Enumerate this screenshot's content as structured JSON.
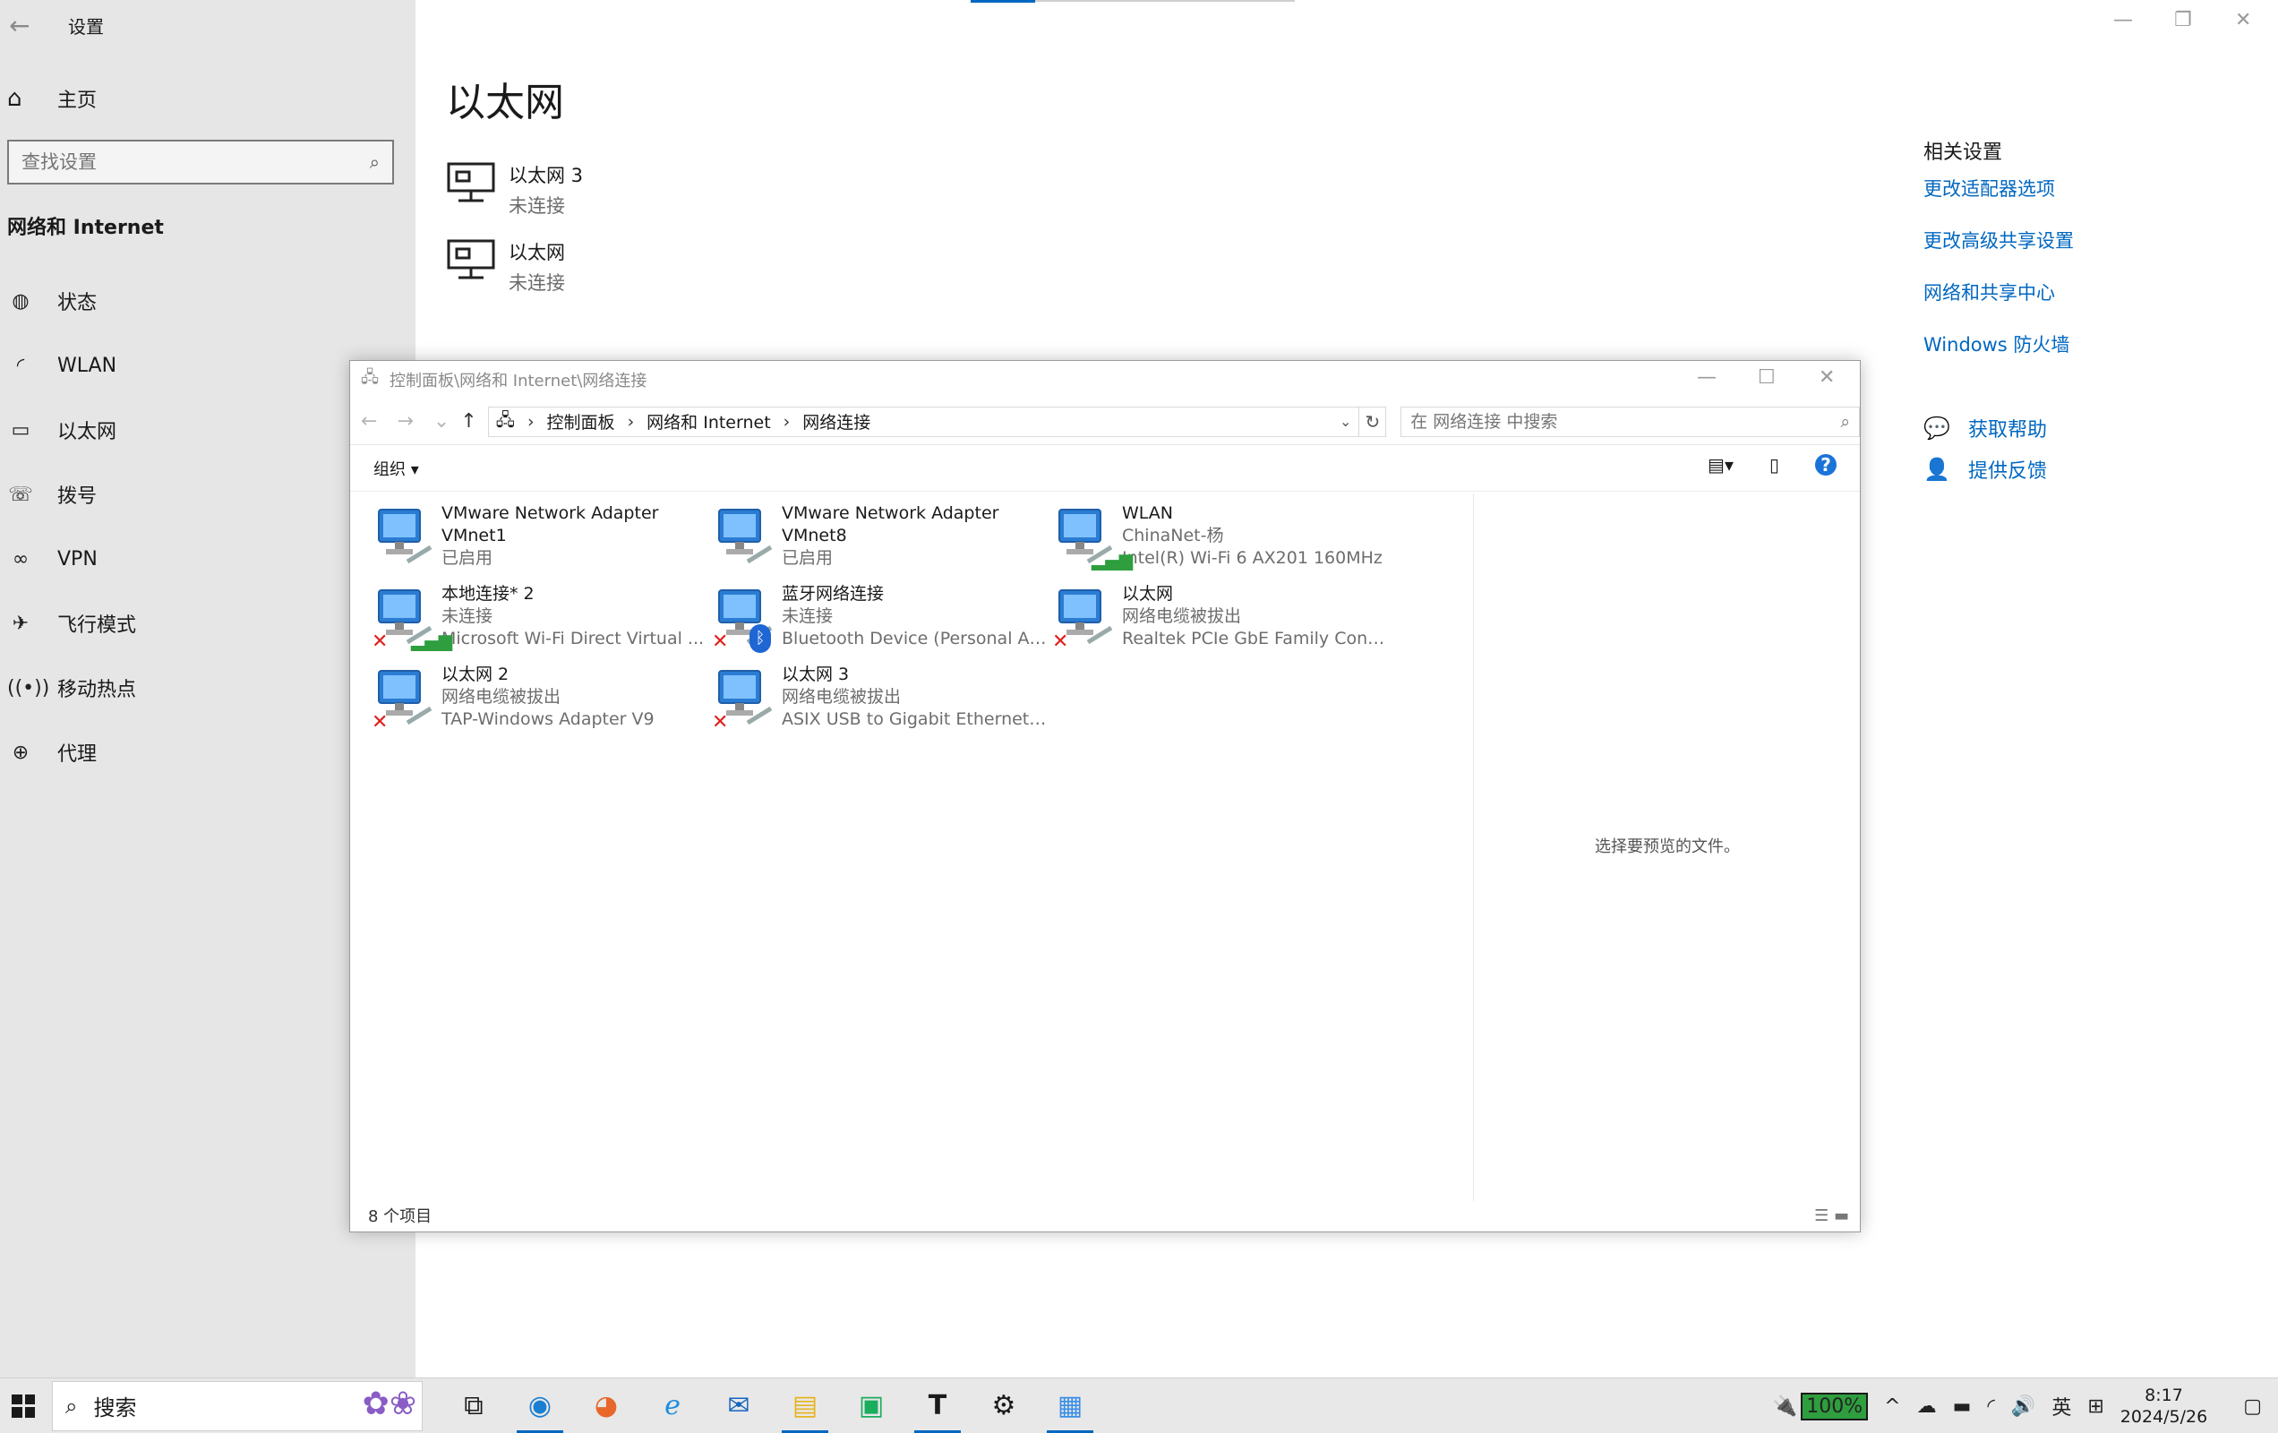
{
  "settings": {
    "window_title": "设置",
    "home_label": "主页",
    "search_placeholder": "查找设置",
    "section_title": "网络和 Internet",
    "nav": [
      {
        "label": "状态",
        "icon": "globe-status-icon"
      },
      {
        "label": "WLAN",
        "icon": "wifi-icon"
      },
      {
        "label": "以太网",
        "icon": "ethernet-icon"
      },
      {
        "label": "拨号",
        "icon": "dialup-icon"
      },
      {
        "label": "VPN",
        "icon": "vpn-icon"
      },
      {
        "label": "飞行模式",
        "icon": "airplane-icon"
      },
      {
        "label": "移动热点",
        "icon": "hotspot-icon"
      },
      {
        "label": "代理",
        "icon": "globe-icon"
      }
    ],
    "page_title": "以太网",
    "adapters": [
      {
        "name": "以太网 3",
        "status": "未连接"
      },
      {
        "name": "以太网",
        "status": "未连接"
      }
    ],
    "related": {
      "heading": "相关设置",
      "links": [
        "更改适配器选项",
        "更改高级共享设置",
        "网络和共享中心",
        "Windows 防火墙"
      ]
    },
    "help": {
      "get_help": "获取帮助",
      "feedback": "提供反馈"
    }
  },
  "explorer": {
    "title": "控制面板\\网络和 Internet\\网络连接",
    "breadcrumb": [
      "控制面板",
      "网络和 Internet",
      "网络连接"
    ],
    "search_placeholder": "在 网络连接 中搜索",
    "organize": "组织 ▾",
    "preview_text": "选择要预览的文件。",
    "status": "8 个项目",
    "items": [
      {
        "name": "VMware Network Adapter VMnet1",
        "line2": "已启用",
        "line3": "",
        "badge": "cable"
      },
      {
        "name": "VMware Network Adapter VMnet8",
        "line2": "已启用",
        "line3": "",
        "badge": "cable"
      },
      {
        "name": "WLAN",
        "line2": "ChinaNet-杨",
        "line3": "Intel(R) Wi-Fi 6 AX201 160MHz",
        "badge": "signal"
      },
      {
        "name": "本地连接* 2",
        "line2": "未连接",
        "line3": "Microsoft Wi-Fi Direct Virtual ...",
        "badge": "x-signal"
      },
      {
        "name": "蓝牙网络连接",
        "line2": "未连接",
        "line3": "Bluetooth Device (Personal Are...",
        "badge": "x-bluetooth"
      },
      {
        "name": "以太网",
        "line2": "网络电缆被拔出",
        "line3": "Realtek PCIe GbE Family Contr...",
        "badge": "x-cable"
      },
      {
        "name": "以太网 2",
        "line2": "网络电缆被拔出",
        "line3": "TAP-Windows Adapter V9",
        "badge": "x-cable"
      },
      {
        "name": "以太网 3",
        "line2": "网络电缆被拔出",
        "line3": "ASIX USB to Gigabit Ethernet F...",
        "badge": "x-cable"
      }
    ]
  },
  "taskbar": {
    "search_label": "搜索",
    "battery": "100%",
    "ime": "英",
    "time": "8:17",
    "date": "2024/5/26"
  },
  "colors": {
    "accent": "#0067c0",
    "sidebar_bg": "#e6e6e6",
    "error": "#e0201c"
  }
}
